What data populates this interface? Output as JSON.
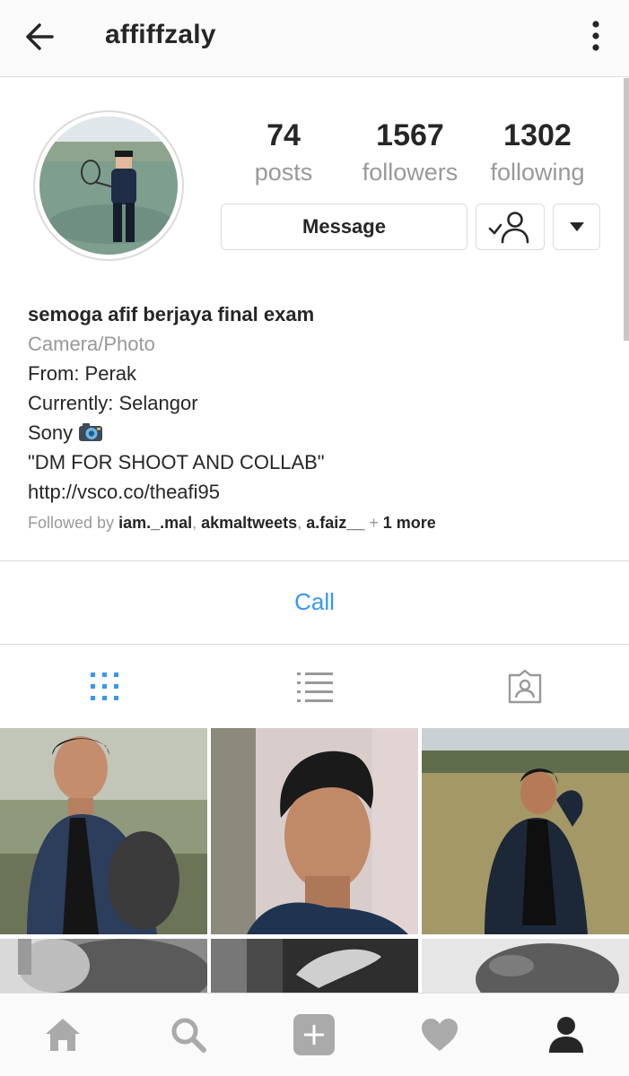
{
  "header": {
    "username": "affiffzaly"
  },
  "stats": [
    {
      "number": "74",
      "label": "posts"
    },
    {
      "number": "1567",
      "label": "followers"
    },
    {
      "number": "1302",
      "label": "following"
    }
  ],
  "actions": {
    "message_label": "Message"
  },
  "bio": {
    "name": "semoga afif berjaya final exam",
    "category": "Camera/Photo",
    "line1": "From: Perak",
    "line2": "Currently: Selangor",
    "line3": "Sony",
    "line4": "\"DM FOR SHOOT AND COLLAB\"",
    "link": "http://vsco.co/theafi95",
    "followed_by_prefix": "Followed by",
    "followed_by_users": [
      "iam._.mal",
      "akmaltweets",
      "a.faiz__"
    ],
    "followed_by_more": "1 more"
  },
  "call_label": "Call",
  "colors": {
    "accent": "#3897f0",
    "muted": "#999999",
    "text": "#262626",
    "border": "#dbdbdb"
  },
  "icons": {
    "header": [
      "back-arrow-icon",
      "more-vertical-icon"
    ],
    "view_tabs": [
      "grid-view-icon",
      "list-view-icon",
      "tagged-icon"
    ],
    "bottom_nav": [
      "home-icon",
      "search-icon",
      "add-post-icon",
      "heart-icon",
      "profile-icon"
    ]
  }
}
